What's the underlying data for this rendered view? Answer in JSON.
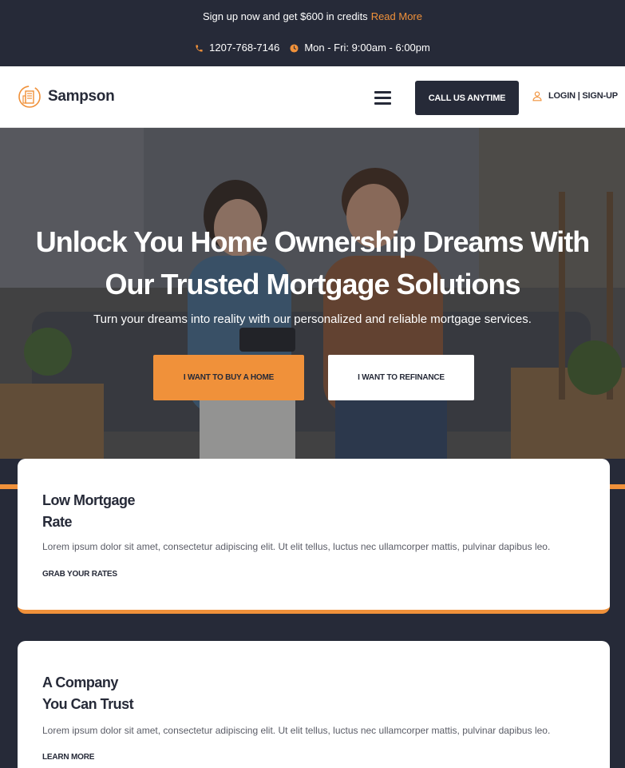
{
  "topbar": {
    "promo_text": "Sign up now and get $600 in credits",
    "promo_link": "Read More",
    "phone": "1207-768-7146",
    "hours": "Mon - Fri: 9:00am - 6:00pm",
    "phone_icon": "phone-icon",
    "hours_icon": "clock-icon"
  },
  "header": {
    "logo_text": "Sampson",
    "logo_icon": "building-logo-icon",
    "menu_icon": "hamburger-menu-icon",
    "call_label": "CALL US ANYTIME",
    "login_label": "LOGIN | SIGN-UP",
    "login_icon": "user-icon"
  },
  "hero": {
    "title_line1": "Unlock You Home Ownership Dreams With",
    "title_line2": "Our Trusted Mortgage Solutions",
    "subtitle": "Turn your dreams into reality with our personalized and reliable mortgage services.",
    "buy_label": "I WANT TO BUY A HOME",
    "refinance_label": "I WANT TO REFINANCE"
  },
  "cards": [
    {
      "title_line1": "Low Mortgage",
      "title_line2": "Rate",
      "text": "Lorem ipsum dolor sit amet, consectetur adipiscing elit. Ut elit tellus, luctus nec ullamcorper mattis, pulvinar dapibus leo.",
      "cta": "GRAB YOUR RATES"
    },
    {
      "title_line1": "A Company",
      "title_line2": "You Can Trust",
      "text": "Lorem ipsum dolor sit amet, consectetur adipiscing elit. Ut elit tellus, luctus nec ullamcorper mattis, pulvinar dapibus leo.",
      "cta": "LEARN MORE"
    }
  ],
  "colors": {
    "dark": "#262a38",
    "accent": "#f0913a",
    "white": "#ffffff"
  }
}
